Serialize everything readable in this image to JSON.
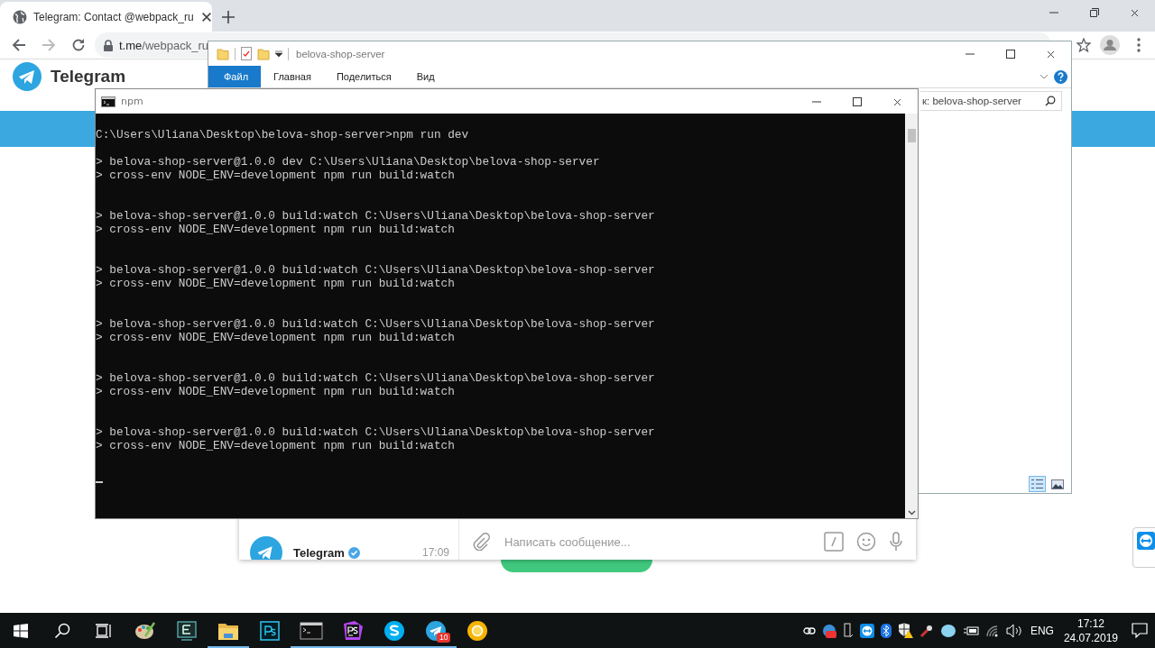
{
  "browser": {
    "tab_title": "Telegram: Contact @webpack_ru",
    "url_host": "t.me",
    "url_path": "/webpack_ru"
  },
  "page": {
    "brand": "Telegram",
    "chat_list": [
      {
        "title": "Telegram",
        "time": "17:09",
        "kind": "verified"
      }
    ],
    "composer": {
      "placeholder": "Написать сообщение..."
    }
  },
  "explorer": {
    "title": "belova-shop-server",
    "tabs": [
      {
        "label": "Файл",
        "selected": true
      },
      {
        "label": "Главная",
        "selected": false
      },
      {
        "label": "Поделиться",
        "selected": false
      },
      {
        "label": "Вид",
        "selected": false
      }
    ],
    "search": "к: belova-shop-server",
    "views": [
      {
        "kind": "details",
        "selected": true
      },
      {
        "kind": "large",
        "selected": false
      }
    ]
  },
  "console": {
    "title": "npm",
    "command": "C:\\Users\\Uliana\\Desktop\\belova-shop-server>npm run dev",
    "entries": [
      {
        "script": "> belova-shop-server@1.0.0 dev C:\\Users\\Uliana\\Desktop\\belova-shop-server",
        "run": "> cross-env NODE_ENV=development npm run build:watch"
      },
      {
        "script": "> belova-shop-server@1.0.0 build:watch C:\\Users\\Uliana\\Desktop\\belova-shop-server",
        "run": "> cross-env NODE_ENV=development npm run build:watch"
      },
      {
        "script": "> belova-shop-server@1.0.0 build:watch C:\\Users\\Uliana\\Desktop\\belova-shop-server",
        "run": "> cross-env NODE_ENV=development npm run build:watch"
      },
      {
        "script": "> belova-shop-server@1.0.0 build:watch C:\\Users\\Uliana\\Desktop\\belova-shop-server",
        "run": "> cross-env NODE_ENV=development npm run build:watch"
      },
      {
        "script": "> belova-shop-server@1.0.0 build:watch C:\\Users\\Uliana\\Desktop\\belova-shop-server",
        "run": "> cross-env NODE_ENV=development npm run build:watch"
      },
      {
        "script": "> belova-shop-server@1.0.0 build:watch C:\\Users\\Uliana\\Desktop\\belova-shop-server",
        "run": "> cross-env NODE_ENV=development npm run build:watch"
      }
    ]
  },
  "taskbar": {
    "apps": [
      {
        "kind": "start",
        "running": false
      },
      {
        "kind": "search",
        "running": false
      },
      {
        "kind": "taskview",
        "running": false
      },
      {
        "kind": "paint",
        "running": false
      },
      {
        "kind": "editor",
        "running": false
      },
      {
        "kind": "folder",
        "running": true
      },
      {
        "kind": "ps",
        "running": false
      },
      {
        "kind": "terminal",
        "running": true
      },
      {
        "kind": "storm",
        "running": true
      },
      {
        "kind": "skype",
        "running": true
      },
      {
        "kind": "telegram",
        "running": true,
        "badge": "10"
      },
      {
        "kind": "chrome",
        "running": false
      }
    ],
    "language": "ENG",
    "time": "17:12",
    "date": "24.07.2019"
  }
}
